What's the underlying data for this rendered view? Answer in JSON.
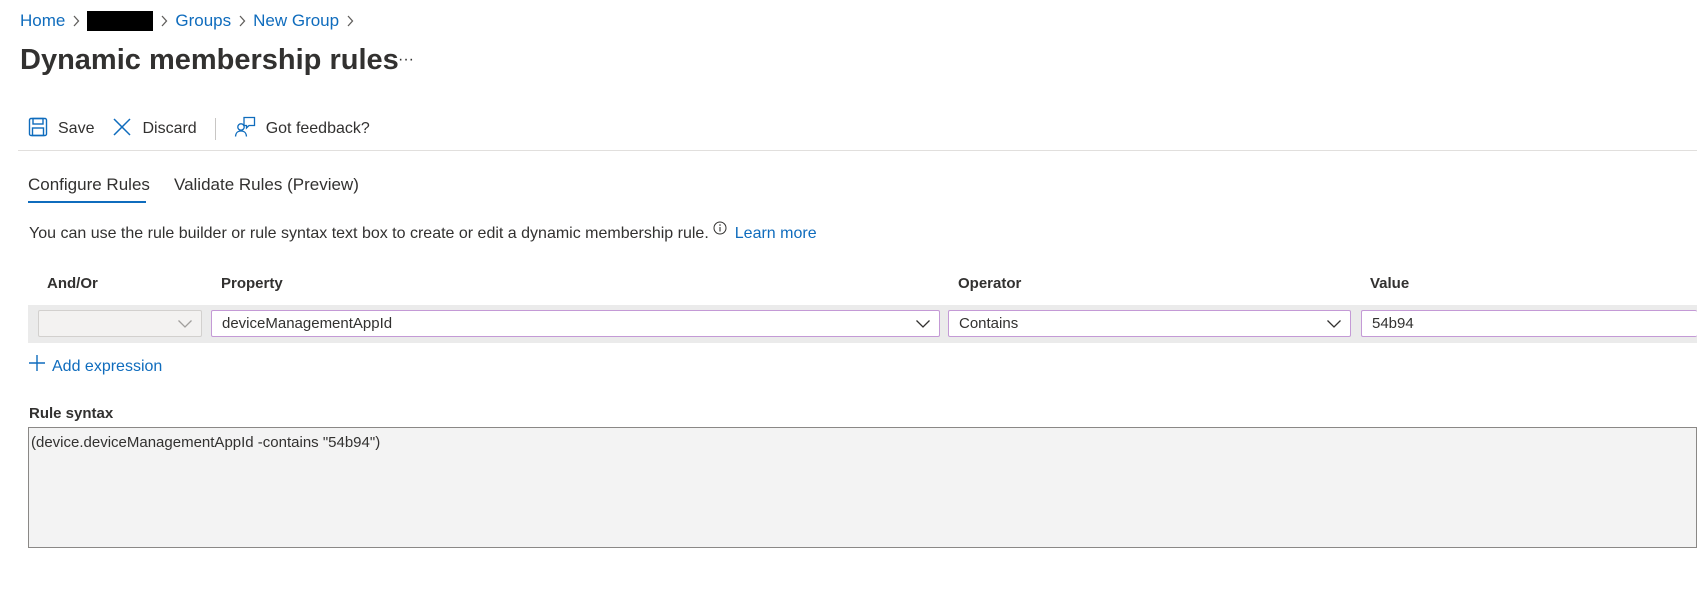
{
  "breadcrumb": {
    "home": "Home",
    "groups": "Groups",
    "new_group": "New Group"
  },
  "page": {
    "title": "Dynamic membership rules",
    "more": "···"
  },
  "toolbar": {
    "save": "Save",
    "discard": "Discard",
    "feedback": "Got feedback?"
  },
  "tabs": [
    {
      "label": "Configure Rules",
      "active": true
    },
    {
      "label": "Validate Rules (Preview)",
      "active": false
    }
  ],
  "description": {
    "text": "You can use the rule builder or rule syntax text box to create or edit a dynamic membership rule.",
    "learn_more": "Learn more"
  },
  "columns": {
    "and_or": "And/Or",
    "property": "Property",
    "operator": "Operator",
    "value": "Value"
  },
  "rule_row": {
    "and_or": "",
    "property": "deviceManagementAppId",
    "operator": "Contains",
    "value": "54b94"
  },
  "add_expression": "Add expression",
  "rule_syntax": {
    "label": "Rule syntax",
    "value": "(device.deviceManagementAppId -contains \"54b94\")"
  },
  "colors": {
    "accent": "#0f6cbd",
    "field_border": "#c49ad6",
    "text": "#323130"
  }
}
